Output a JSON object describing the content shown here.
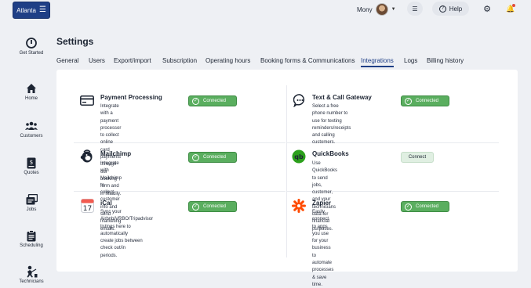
{
  "topbar": {
    "brand_label": "Atlanta",
    "user_name": "Mony",
    "help_label": "Help"
  },
  "sidebar": {
    "items": [
      {
        "label": "Get Started",
        "icon": "power-icon"
      },
      {
        "label": "Home",
        "icon": "home-icon"
      },
      {
        "label": "Customers",
        "icon": "users-icon"
      },
      {
        "label": "Quotes",
        "icon": "dollar-document-icon"
      },
      {
        "label": "Jobs",
        "icon": "jobs-icon"
      },
      {
        "label": "Scheduling",
        "icon": "clipboard-icon"
      },
      {
        "label": "Technicians",
        "icon": "technician-icon"
      }
    ]
  },
  "page": {
    "title": "Settings"
  },
  "tabs": [
    {
      "label": "General"
    },
    {
      "label": "Users"
    },
    {
      "label": "Export/import"
    },
    {
      "label": "Subscription"
    },
    {
      "label": "Operating hours"
    },
    {
      "label": "Booking forms & Communications"
    },
    {
      "label": "Integrations",
      "active": true
    },
    {
      "label": "Logs"
    },
    {
      "label": "Billing history"
    }
  ],
  "integrations": [
    {
      "title": "Payment Processing",
      "icon": "credit-card-icon",
      "desc": [
        "Integrate with a payment",
        "processor to collect online card",
        "payments through our booking",
        "form and in Maidily."
      ],
      "status": "Connected"
    },
    {
      "title": "Text & Call Gateway",
      "icon": "chat-bubble-icon",
      "desc": [
        "Select a free phone number to",
        "use for texting reminders/receipts",
        "and calling customers."
      ],
      "status": "Connected"
    },
    {
      "title": "Mailchimp",
      "icon": "mailchimp-icon",
      "desc": [
        "Integrate with Mailchimp to",
        "collect customer info and send",
        "marketing emails."
      ],
      "status": "Connected"
    },
    {
      "title": "QuickBooks",
      "icon": "quickbooks-icon",
      "desc": [
        "Use QuickBooks to send jobs,",
        "customer, and your technicians",
        "data for financial purposes."
      ],
      "status": "Connect"
    },
    {
      "title": "iCal",
      "icon": "calendar-icon",
      "calendar_day": "17",
      "desc": [
        "Sync your",
        "Airbnb/VRBO/Tripadvisor",
        "listings here to automatically",
        "create jobs between check out/in",
        "periods."
      ],
      "status": "Connected"
    },
    {
      "title": "Zapier",
      "icon": "zapier-icon",
      "desc": [
        "Easily connect to apps you use",
        "for your business to automate",
        "processes & save time."
      ],
      "status": "Connected"
    }
  ],
  "colors": {
    "brand": "#1f3f86",
    "connected": "#5aae5f",
    "connect": "#e0efe2",
    "quickbooks": "#2ca01c",
    "zapier": "#ff4a00"
  }
}
